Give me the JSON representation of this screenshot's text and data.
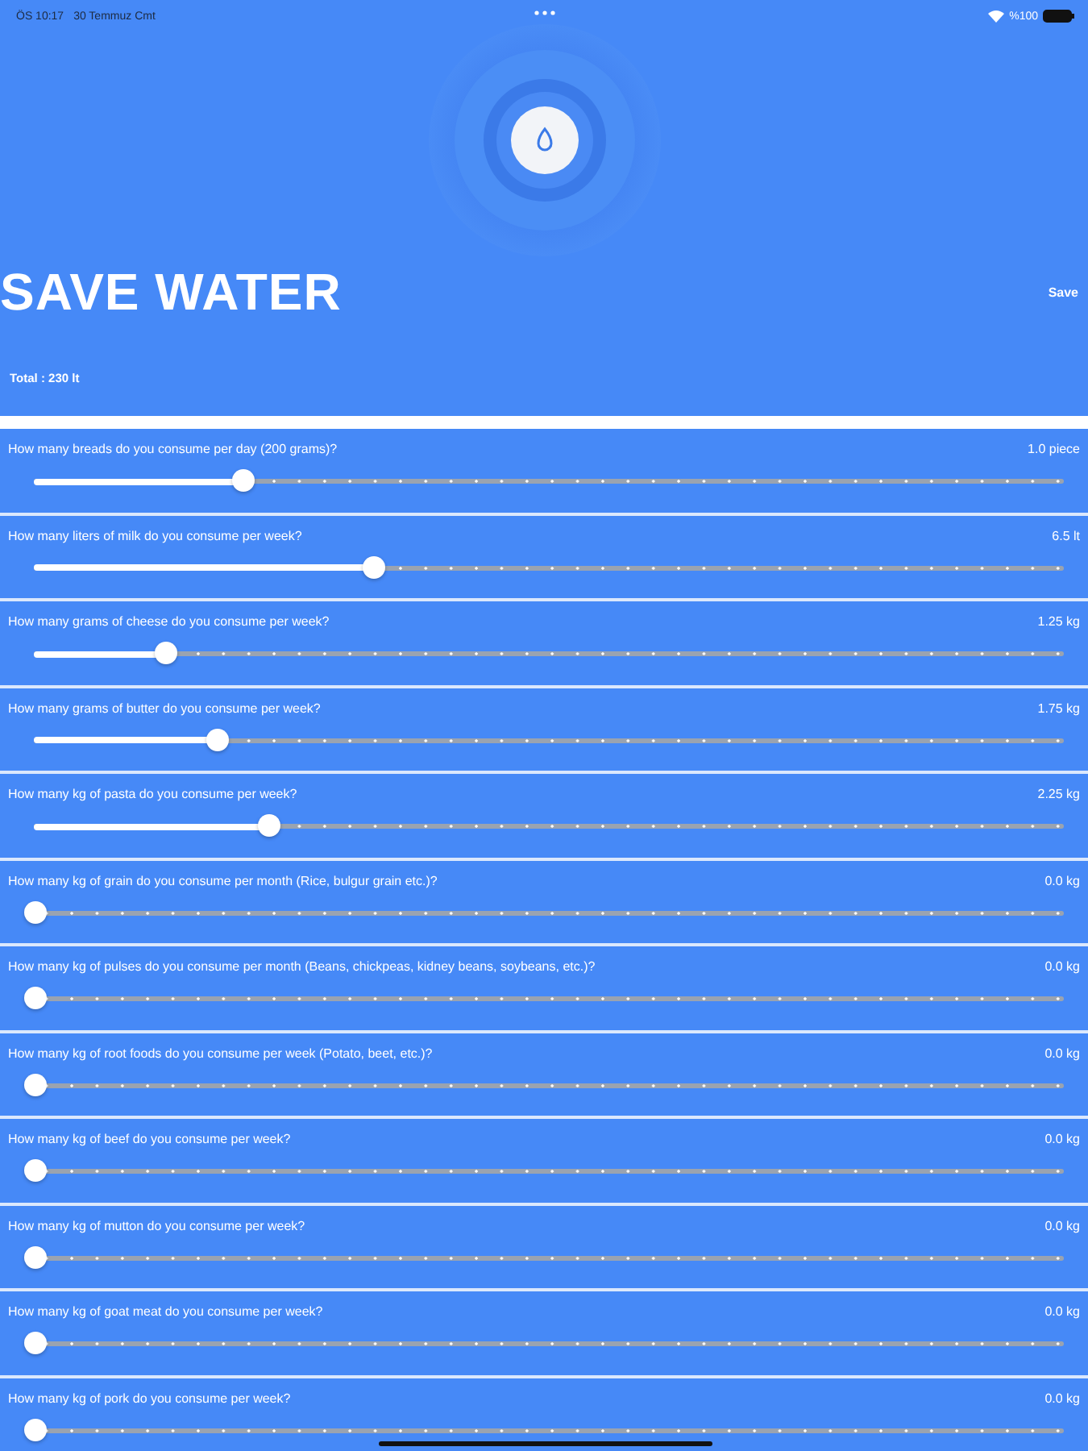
{
  "status_bar": {
    "time": "ÖS 10:17",
    "date": "30 Temmuz Cmt",
    "battery": "%100"
  },
  "header": {
    "title": "SAVE WATER",
    "save": "Save",
    "total": "Total : 230 lt"
  },
  "questions": [
    {
      "label": "How many breads do you consume per day (200 grams)?",
      "reading": "1.0 piece",
      "level": 0.2
    },
    {
      "label": "How many liters of milk do you consume per week?",
      "reading": "6.5 lt",
      "level": 0.325
    },
    {
      "label": "How many grams of cheese do you consume per week?",
      "reading": "1.25 kg",
      "level": 0.125
    },
    {
      "label": "How many grams of butter do you consume per week?",
      "reading": "1.75 kg",
      "level": 0.175
    },
    {
      "label": "How many kg of pasta do you consume per week?",
      "reading": "2.25 kg",
      "level": 0.225
    },
    {
      "label": "How many kg of grain do you consume per month (Rice, bulgur grain etc.)?",
      "reading": "0.0 kg",
      "level": 0
    },
    {
      "label": "How many kg of pulses do you consume per month (Beans, chickpeas, kidney beans, soybeans, etc.)?",
      "reading": "0.0 kg",
      "level": 0
    },
    {
      "label": "How many kg of root foods do you consume per week (Potato, beet, etc.)?",
      "reading": "0.0 kg",
      "level": 0
    },
    {
      "label": "How many kg of beef do you consume per week?",
      "reading": "0.0 kg",
      "level": 0
    },
    {
      "label": "How many kg of mutton do you consume per week?",
      "reading": "0.0 kg",
      "level": 0
    },
    {
      "label": "How many kg of goat meat do you consume per week?",
      "reading": "0.0 kg",
      "level": 0
    },
    {
      "label": "How many kg of pork do you consume per week?",
      "reading": "0.0 kg",
      "level": 0
    }
  ]
}
